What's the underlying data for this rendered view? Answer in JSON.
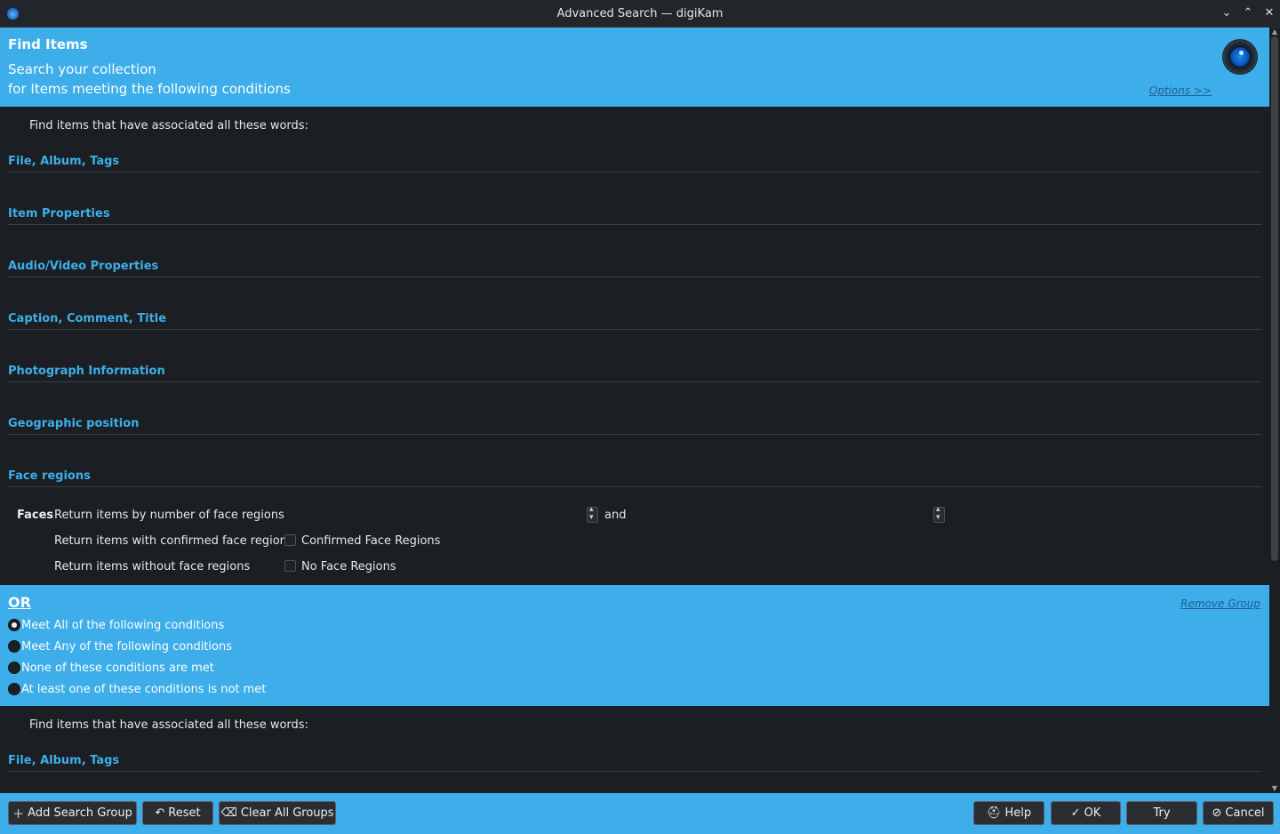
{
  "window": {
    "title": "Advanced Search — digiKam",
    "controls": [
      "⌄",
      "⌃",
      "✕"
    ]
  },
  "header": {
    "title": "Find Items",
    "subtitle1": "Search your collection",
    "subtitle2": "for Items meeting the following conditions",
    "options_link": "Options >>"
  },
  "group1": {
    "keywords_label": "Find items that have associated all these words:",
    "sections": [
      "File, Album, Tags",
      "Item Properties",
      "Audio/Video Properties",
      "Caption, Comment, Title",
      "Photograph Information",
      "Geographic position",
      "Face regions"
    ],
    "faces": {
      "label": "Faces",
      "row1": "Return items by number of face regions",
      "and": "and",
      "row2": "Return items with confirmed face regions",
      "row2_checkbox": "Confirmed Face Regions",
      "row3": "Return items without face regions",
      "row3_checkbox": "No Face Regions"
    }
  },
  "or_group": {
    "title": "OR",
    "remove_link": "Remove Group",
    "options": [
      {
        "label": "Meet All of the following conditions",
        "checked": true
      },
      {
        "label": "Meet Any of the following conditions",
        "checked": false
      },
      {
        "label": "None of these conditions are met",
        "checked": false
      },
      {
        "label": "At least one of these conditions is not met",
        "checked": false
      }
    ]
  },
  "group2": {
    "keywords_label": "Find items that have associated all these words:",
    "first_section": "File, Album, Tags"
  },
  "buttons": {
    "add_group": "Add Search Group",
    "reset": "Reset",
    "clear_all": "Clear All Groups",
    "help": "Help",
    "ok": "OK",
    "try": "Try",
    "cancel": "Cancel"
  },
  "colors": {
    "accent": "#3daee9",
    "background": "#1b1e22",
    "link": "#1f5f99"
  }
}
